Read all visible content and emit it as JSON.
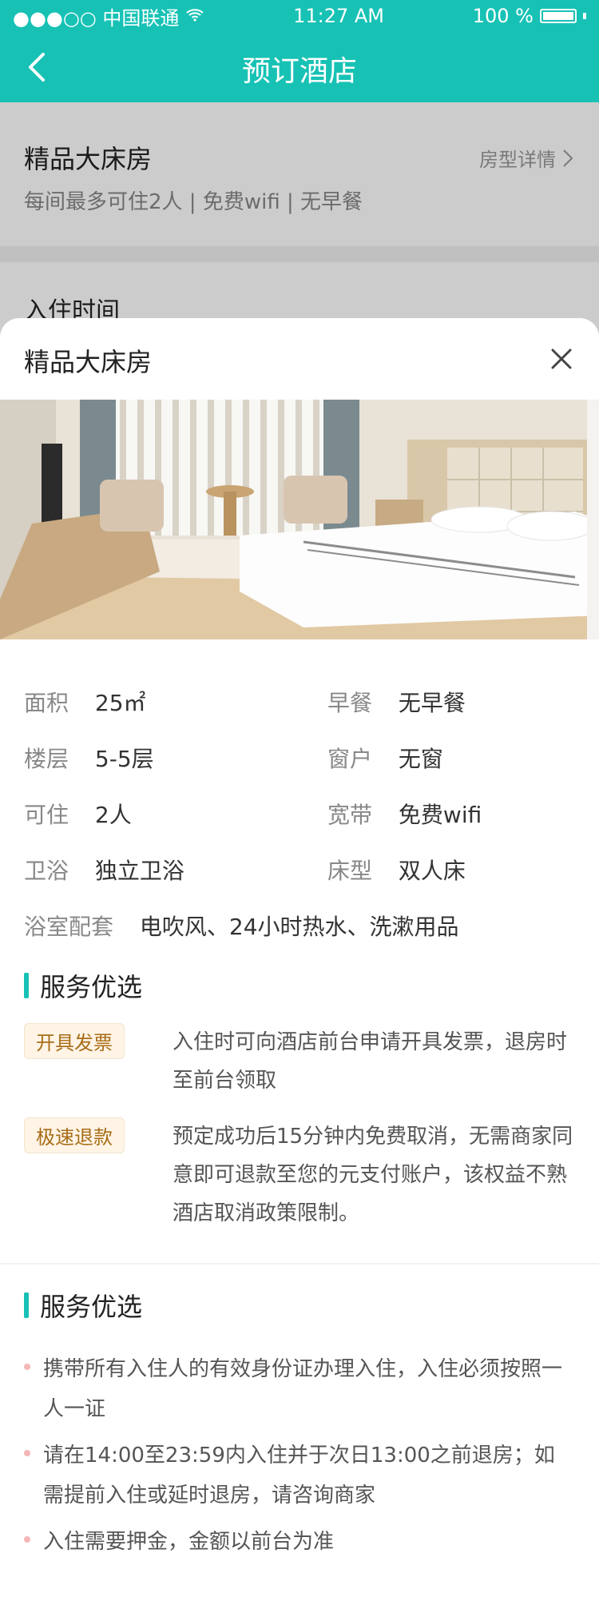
{
  "status_bar": {
    "carrier": "●●●○○ 中国联通",
    "time": "11:27 AM",
    "battery": "100 %"
  },
  "nav": {
    "title": "预订酒店"
  },
  "background": {
    "room_title": "精品大床房",
    "room_detail_link": "房型详情",
    "room_desc": "每间最多可住2人 | 免费wifi | 无早餐",
    "checkin_label": "入住时间"
  },
  "sheet": {
    "title": "精品大床房",
    "properties": [
      {
        "label": "面积",
        "value": "25㎡"
      },
      {
        "label": "早餐",
        "value": "无早餐"
      },
      {
        "label": "楼层",
        "value": "5-5层"
      },
      {
        "label": "窗户",
        "value": "无窗"
      },
      {
        "label": "可住",
        "value": "2人"
      },
      {
        "label": "宽带",
        "value": "免费wifi"
      },
      {
        "label": "卫浴",
        "value": "独立卫浴"
      },
      {
        "label": "床型",
        "value": "双人床"
      },
      {
        "label": "浴室配套",
        "value": "电吹风、24小时热水、洗漱用品"
      }
    ],
    "section1_title": "服务优选",
    "services": [
      {
        "badge": "开具发票",
        "text": "入住时可向酒店前台申请开具发票，退房时至前台领取"
      },
      {
        "badge": "极速退款",
        "text": "预定成功后15分钟内免费取消，无需商家同意即可退款至您的元支付账户，该权益不熟酒店取消政策限制。"
      }
    ],
    "section2_title": "服务优选",
    "notes": [
      "携带所有入住人的有效身份证办理入住，入住必须按照一人一证",
      "请在14:00至23:59内入住并于次日13:00之前退房；如需提前入住或延时退房，请咨询商家",
      "入住需要押金，金额以前台为准"
    ]
  },
  "colors": {
    "accent": "#17c2b5",
    "badge_bg": "#fff4e6",
    "badge_text": "#a86d17"
  },
  "icons": {
    "back": "chevron-left-icon",
    "close": "close-icon",
    "detail": "chevron-right-icon",
    "wifi": "wifi-icon",
    "battery": "battery-icon"
  }
}
